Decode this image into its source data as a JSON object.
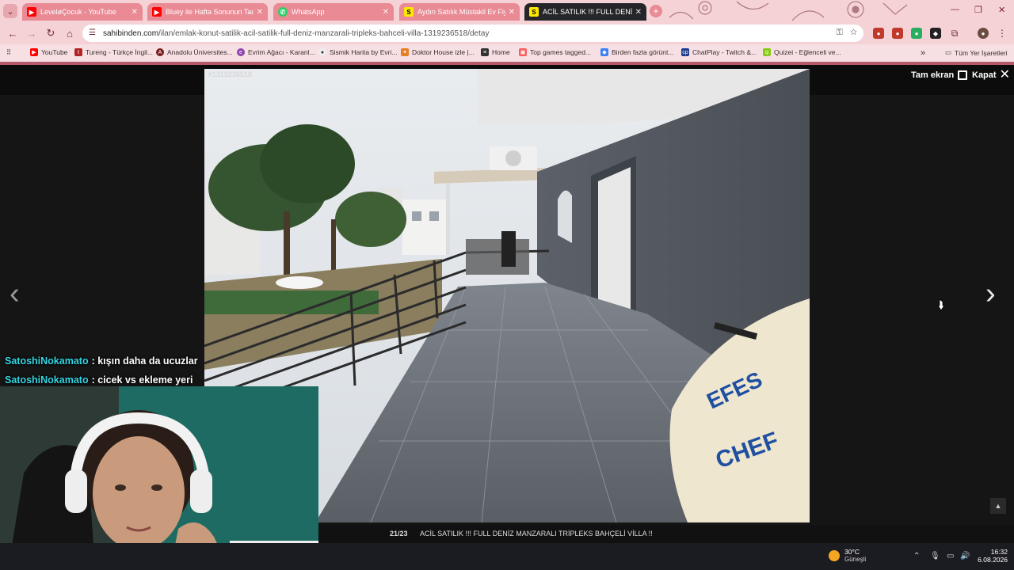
{
  "browser": {
    "tabs": [
      {
        "title": "LeveløÇocuk - YouTube",
        "icon": "youtube-icon",
        "active": false
      },
      {
        "title": "Bluey ile Hafta Sonunun Tadını",
        "icon": "youtube-icon",
        "active": false
      },
      {
        "title": "WhatsApp",
        "icon": "whatsapp-icon",
        "active": false
      },
      {
        "title": "Aydın Satılık Müstakil Ev Fiyatları",
        "icon": "sahibinden-icon",
        "active": false
      },
      {
        "title": "ACİL SATILIK !!! FULL DENİZ MA",
        "icon": "sahibinden-icon",
        "active": true
      }
    ],
    "url_domain": "sahibinden.com",
    "url_path": "/ilan/emlak-konut-satilik-acil-satilik-full-deniz-manzarali-tripleks-bahceli-villa-1319236518/detay",
    "bookmarks": [
      {
        "label": "YouTube",
        "icon": "youtube-icon"
      },
      {
        "label": "Tureng - Türkçe İngil...",
        "icon": "tureng-icon"
      },
      {
        "label": "Anadolu Üniversites...",
        "icon": "anadolu-icon"
      },
      {
        "label": "Evrim Ağacı - Karanl...",
        "icon": "evrim-icon"
      },
      {
        "label": "Sismik Harita by Evri...",
        "icon": "sismik-icon"
      },
      {
        "label": "Doktor House izle |...",
        "icon": "doktor-icon"
      },
      {
        "label": "Home",
        "icon": "home-icon"
      },
      {
        "label": "Top games tagged...",
        "icon": "itch-icon"
      },
      {
        "label": "Birden fazla görünt...",
        "icon": "gem-icon"
      },
      {
        "label": "ChatPlay - Twitch &...",
        "icon": "chatplay-icon"
      },
      {
        "label": "Quizei - Eğlenceli ve...",
        "icon": "quizei-icon"
      }
    ],
    "all_bookmarks": "Tüm Yer İşaretleri",
    "more_bookmarks": "»"
  },
  "viewer": {
    "photo_id": "#1319236518",
    "fullscreen_label": "Tam ekran",
    "close_label": "Kapat",
    "counter": "21/23",
    "listing_title": "ACİL SATILIK !!! FULL DENİZ MANZARALI TRİPLEKS BAHÇELİ VİLLA !!",
    "prev_arrow": "‹",
    "next_arrow": "›"
  },
  "chat": [
    {
      "user": "SatoshiNokamato",
      "message": ": kışın daha da ucuzlar"
    },
    {
      "user": "SatoshiNokamato",
      "message": ": cicek vs ekleme yeri"
    }
  ],
  "taskbar": {
    "temperature": "30°C",
    "weather": "Güneşli",
    "time": "16:32",
    "date": "6.08.2026"
  },
  "colors": {
    "chrome_bg": "#f4d2d6",
    "tab_inactive": "#e98a94",
    "chat_user": "#33d6e5",
    "viewer_bg": "#151515"
  }
}
